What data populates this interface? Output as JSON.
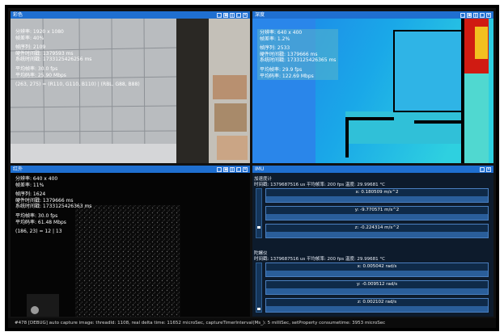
{
  "panels": {
    "color": {
      "title": "彩色",
      "lines": [
        "分辨率: 1920 x 1080",
        "帧差率: 40%",
        "帧序列: 2109",
        "硬件时间戳: 1379593 ms",
        "系统时间戳: 1733125426256 ms",
        "",
        "平均帧率: 30.0 fps",
        "平均码率: 25.90 Mbps",
        "",
        "(263, 275) = (R110, G110, B110) | (RBL, G88, B88)"
      ]
    },
    "depth": {
      "title": "深度",
      "lines": [
        "分辨率: 640 x 400",
        "帧差率: 1.2%",
        "帧序列: 2533",
        "硬件时间戳: 1379666 ms",
        "系统时间戳: 1733125426365 ms",
        "",
        "平均帧率: 29.9 fps",
        "平均码率: 122.69 Mbps"
      ]
    },
    "ir": {
      "title": "红外",
      "lines": [
        "分辨率: 640 x 400",
        "帧差率: 11%",
        "帧序列: 1624",
        "硬件时间戳: 1379666 ms",
        "系统时间戳: 1733125426363 ms",
        "",
        "平均帧率: 30.0 fps",
        "平均码率: 61.48 Mbps",
        "",
        "(186, 23) = 12 | 13"
      ]
    },
    "imu": {
      "title": "IMU",
      "accel": {
        "header": "加速度计",
        "stats": "时间戳: 1379687516 us  平均帧率: 200 fps  温度: 29.99681 °C",
        "x": "x: 0.180509 m/s^2",
        "y": "y: -9.770571 m/s^2",
        "z": "z: -0.224314 m/s^2"
      },
      "gyro": {
        "header": "陀螺仪",
        "stats": "时间戳: 1379687516 us  平均帧率: 200 fps  温度: 29.99681 °C",
        "x": "x: 0.005042 rad/s",
        "y": "y: -0.009512 rad/s",
        "z": "z: 0.002102 rad/s"
      }
    }
  },
  "window_buttons": [
    "⛶",
    "▣",
    "‖",
    "□",
    "✕"
  ],
  "status_bar": "#478 [DEBUG] auto capture image: threadId: 1108, real delta time: 11652 microSec, captureTimerInterval(Ms_): 5 milliSec, setProperty consumetime: 3953 microSec"
}
